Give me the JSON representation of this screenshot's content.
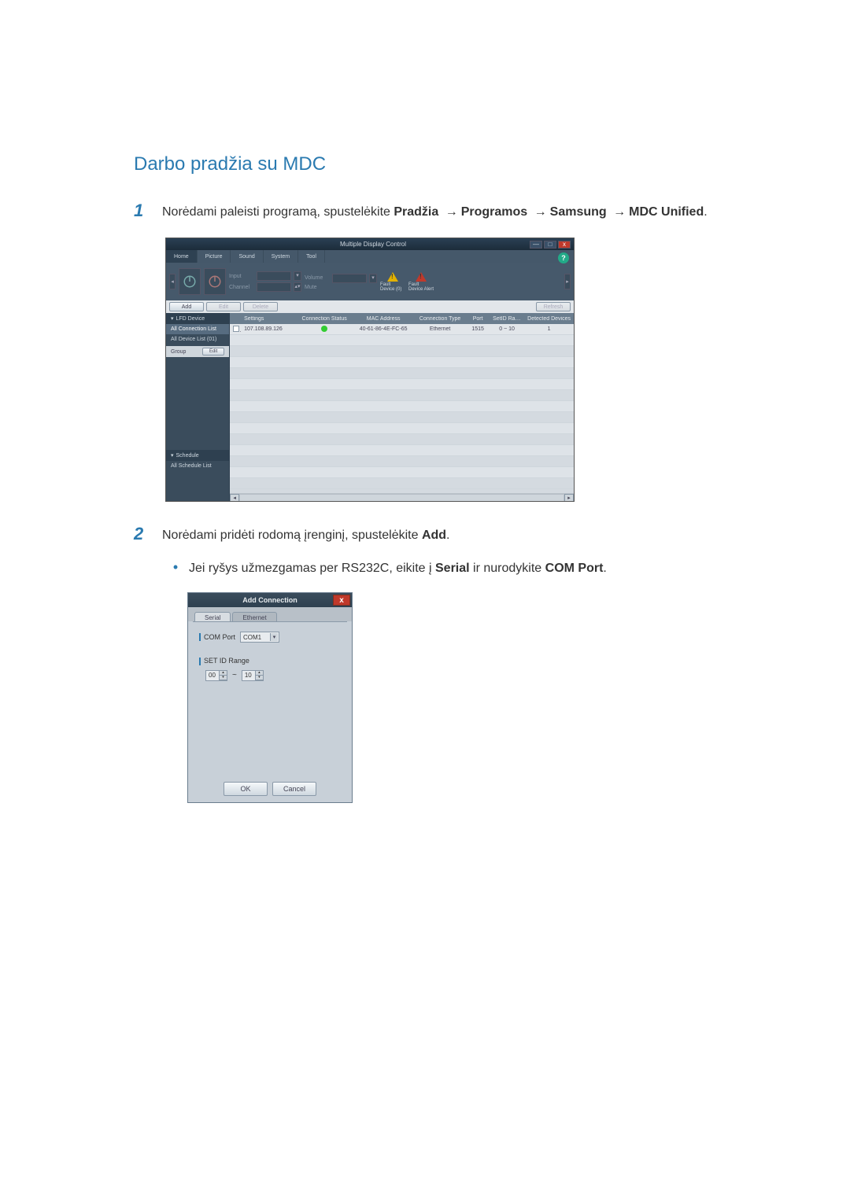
{
  "title": "Darbo pradžia su MDC",
  "step1_pre": "Norėdami paleisti programą, spustelėkite ",
  "step1_p1": "Pradžia",
  "step1_p2": "Programos",
  "step1_p3": "Samsung",
  "step1_p4": "MDC Unified",
  "step1_post": ".",
  "step2_pre": "Norėdami pridėti rodomą įrenginį, spustelėkite ",
  "step2_btn": "Add",
  "step2_post": ".",
  "bullet_pre": "Jei ryšys užmezgamas per RS232C, eikite į ",
  "bullet_serial": "Serial",
  "bullet_mid": " ir nurodykite ",
  "bullet_com": "COM Port",
  "bullet_post": ".",
  "mdc": {
    "wintitle": "Multiple Display Control",
    "winmin": "—",
    "winmax": "□",
    "winclose": "x",
    "help": "?",
    "menu": {
      "home": "Home",
      "picture": "Picture",
      "sound": "Sound",
      "system": "System",
      "tool": "Tool"
    },
    "ribbon": {
      "input": "Input",
      "channel": "Channel",
      "volume": "Volume",
      "mute": "Mute",
      "fdlist": "Fault Device (0)",
      "fdalert": "Fault Device Alert"
    },
    "toolbar": {
      "add": "Add",
      "edit": "Edit",
      "delete": "Delete",
      "refresh": "Refresh"
    },
    "sidebar": {
      "lfd": "LFD Device",
      "allconn": "All Connection List",
      "alldev": "All Device List (01)",
      "group": "Group",
      "edit": "Edit",
      "schedule": "Schedule",
      "allsched": "All Schedule List"
    },
    "thead": {
      "settings": "Settings",
      "conn": "Connection Status",
      "mac": "MAC Address",
      "type": "Connection Type",
      "port": "Port",
      "range": "SetID Range",
      "detected": "Detected Devices"
    },
    "row": {
      "ip": "107.108.89.126",
      "mac": "40-61-86-4E-FC-65",
      "type": "Ethernet",
      "port": "1515",
      "range": "0 ~ 10",
      "det": "1"
    }
  },
  "dlg": {
    "title": "Add Connection",
    "close": "x",
    "tab_serial": "Serial",
    "tab_eth": "Ethernet",
    "comport_lbl": "COM Port",
    "comport_val": "COM1",
    "setid_lbl": "SET ID Range",
    "tilde": "~",
    "range_from": "00",
    "range_to": "10",
    "ok": "OK",
    "cancel": "Cancel"
  }
}
